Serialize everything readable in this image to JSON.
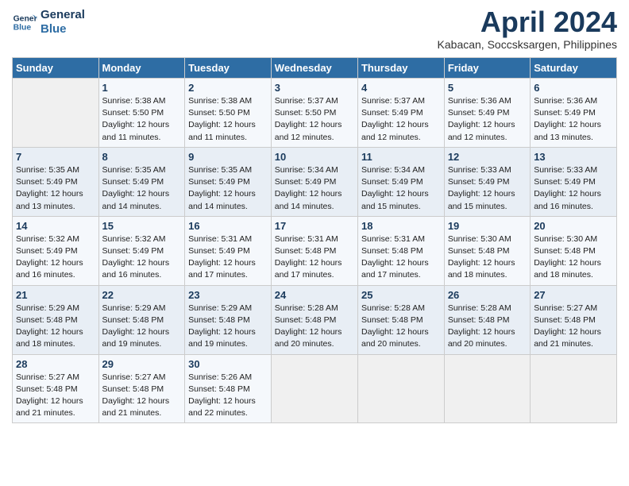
{
  "header": {
    "logo_line1": "General",
    "logo_line2": "Blue",
    "title": "April 2024",
    "subtitle": "Kabacan, Soccsksargen, Philippines"
  },
  "weekdays": [
    "Sunday",
    "Monday",
    "Tuesday",
    "Wednesday",
    "Thursday",
    "Friday",
    "Saturday"
  ],
  "weeks": [
    [
      {
        "day": "",
        "info": ""
      },
      {
        "day": "1",
        "info": "Sunrise: 5:38 AM\nSunset: 5:50 PM\nDaylight: 12 hours\nand 11 minutes."
      },
      {
        "day": "2",
        "info": "Sunrise: 5:38 AM\nSunset: 5:50 PM\nDaylight: 12 hours\nand 11 minutes."
      },
      {
        "day": "3",
        "info": "Sunrise: 5:37 AM\nSunset: 5:50 PM\nDaylight: 12 hours\nand 12 minutes."
      },
      {
        "day": "4",
        "info": "Sunrise: 5:37 AM\nSunset: 5:49 PM\nDaylight: 12 hours\nand 12 minutes."
      },
      {
        "day": "5",
        "info": "Sunrise: 5:36 AM\nSunset: 5:49 PM\nDaylight: 12 hours\nand 12 minutes."
      },
      {
        "day": "6",
        "info": "Sunrise: 5:36 AM\nSunset: 5:49 PM\nDaylight: 12 hours\nand 13 minutes."
      }
    ],
    [
      {
        "day": "7",
        "info": "Sunrise: 5:35 AM\nSunset: 5:49 PM\nDaylight: 12 hours\nand 13 minutes."
      },
      {
        "day": "8",
        "info": "Sunrise: 5:35 AM\nSunset: 5:49 PM\nDaylight: 12 hours\nand 14 minutes."
      },
      {
        "day": "9",
        "info": "Sunrise: 5:35 AM\nSunset: 5:49 PM\nDaylight: 12 hours\nand 14 minutes."
      },
      {
        "day": "10",
        "info": "Sunrise: 5:34 AM\nSunset: 5:49 PM\nDaylight: 12 hours\nand 14 minutes."
      },
      {
        "day": "11",
        "info": "Sunrise: 5:34 AM\nSunset: 5:49 PM\nDaylight: 12 hours\nand 15 minutes."
      },
      {
        "day": "12",
        "info": "Sunrise: 5:33 AM\nSunset: 5:49 PM\nDaylight: 12 hours\nand 15 minutes."
      },
      {
        "day": "13",
        "info": "Sunrise: 5:33 AM\nSunset: 5:49 PM\nDaylight: 12 hours\nand 16 minutes."
      }
    ],
    [
      {
        "day": "14",
        "info": "Sunrise: 5:32 AM\nSunset: 5:49 PM\nDaylight: 12 hours\nand 16 minutes."
      },
      {
        "day": "15",
        "info": "Sunrise: 5:32 AM\nSunset: 5:49 PM\nDaylight: 12 hours\nand 16 minutes."
      },
      {
        "day": "16",
        "info": "Sunrise: 5:31 AM\nSunset: 5:49 PM\nDaylight: 12 hours\nand 17 minutes."
      },
      {
        "day": "17",
        "info": "Sunrise: 5:31 AM\nSunset: 5:48 PM\nDaylight: 12 hours\nand 17 minutes."
      },
      {
        "day": "18",
        "info": "Sunrise: 5:31 AM\nSunset: 5:48 PM\nDaylight: 12 hours\nand 17 minutes."
      },
      {
        "day": "19",
        "info": "Sunrise: 5:30 AM\nSunset: 5:48 PM\nDaylight: 12 hours\nand 18 minutes."
      },
      {
        "day": "20",
        "info": "Sunrise: 5:30 AM\nSunset: 5:48 PM\nDaylight: 12 hours\nand 18 minutes."
      }
    ],
    [
      {
        "day": "21",
        "info": "Sunrise: 5:29 AM\nSunset: 5:48 PM\nDaylight: 12 hours\nand 18 minutes."
      },
      {
        "day": "22",
        "info": "Sunrise: 5:29 AM\nSunset: 5:48 PM\nDaylight: 12 hours\nand 19 minutes."
      },
      {
        "day": "23",
        "info": "Sunrise: 5:29 AM\nSunset: 5:48 PM\nDaylight: 12 hours\nand 19 minutes."
      },
      {
        "day": "24",
        "info": "Sunrise: 5:28 AM\nSunset: 5:48 PM\nDaylight: 12 hours\nand 20 minutes."
      },
      {
        "day": "25",
        "info": "Sunrise: 5:28 AM\nSunset: 5:48 PM\nDaylight: 12 hours\nand 20 minutes."
      },
      {
        "day": "26",
        "info": "Sunrise: 5:28 AM\nSunset: 5:48 PM\nDaylight: 12 hours\nand 20 minutes."
      },
      {
        "day": "27",
        "info": "Sunrise: 5:27 AM\nSunset: 5:48 PM\nDaylight: 12 hours\nand 21 minutes."
      }
    ],
    [
      {
        "day": "28",
        "info": "Sunrise: 5:27 AM\nSunset: 5:48 PM\nDaylight: 12 hours\nand 21 minutes."
      },
      {
        "day": "29",
        "info": "Sunrise: 5:27 AM\nSunset: 5:48 PM\nDaylight: 12 hours\nand 21 minutes."
      },
      {
        "day": "30",
        "info": "Sunrise: 5:26 AM\nSunset: 5:48 PM\nDaylight: 12 hours\nand 22 minutes."
      },
      {
        "day": "",
        "info": ""
      },
      {
        "day": "",
        "info": ""
      },
      {
        "day": "",
        "info": ""
      },
      {
        "day": "",
        "info": ""
      }
    ]
  ]
}
